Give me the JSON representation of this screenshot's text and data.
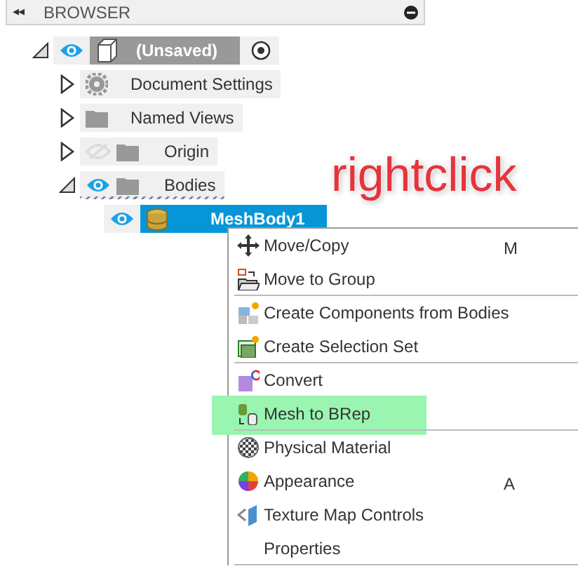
{
  "panel": {
    "collapse_glyph": "◂◂",
    "title": "BROWSER"
  },
  "tree": [
    {
      "label": "(Unsaved)",
      "kind": "component",
      "expanded": true,
      "visible": true,
      "activate": true,
      "children": [
        {
          "label": "Document Settings",
          "kind": "settings",
          "expanded": false,
          "selected": false
        },
        {
          "label": "Named Views",
          "kind": "folder",
          "expanded": false,
          "selected": false
        },
        {
          "label": "Origin",
          "kind": "folder",
          "expanded": false,
          "visible": false,
          "selected": false
        },
        {
          "label": "Bodies",
          "kind": "bodies",
          "expanded": true,
          "visible": true,
          "selected": false,
          "children": [
            {
              "label": "MeshBody1",
              "kind": "mesh",
              "visible": true,
              "selected": true
            }
          ]
        }
      ]
    }
  ],
  "annotation": {
    "text": "rightclick"
  },
  "context_menu": [
    {
      "label": "Move/Copy",
      "shortcut": "M",
      "highlighted": false,
      "separator_after": false
    },
    {
      "label": "Move to Group",
      "highlighted": false,
      "separator_after": true
    },
    {
      "label": "Create Components from Bodies",
      "highlighted": false,
      "separator_after": false
    },
    {
      "label": "Create Selection Set",
      "highlighted": false,
      "separator_after": true
    },
    {
      "label": "Convert",
      "highlighted": false,
      "separator_after": false
    },
    {
      "label": "Mesh to BRep",
      "highlighted": true,
      "separator_after": true
    },
    {
      "label": "Physical Material",
      "highlighted": false,
      "separator_after": false
    },
    {
      "label": "Appearance",
      "shortcut": "A",
      "highlighted": false,
      "separator_after": false
    },
    {
      "label": "Texture Map Controls",
      "highlighted": false,
      "separator_after": false
    },
    {
      "label": "Properties",
      "highlighted": false,
      "separator_after": true
    }
  ]
}
